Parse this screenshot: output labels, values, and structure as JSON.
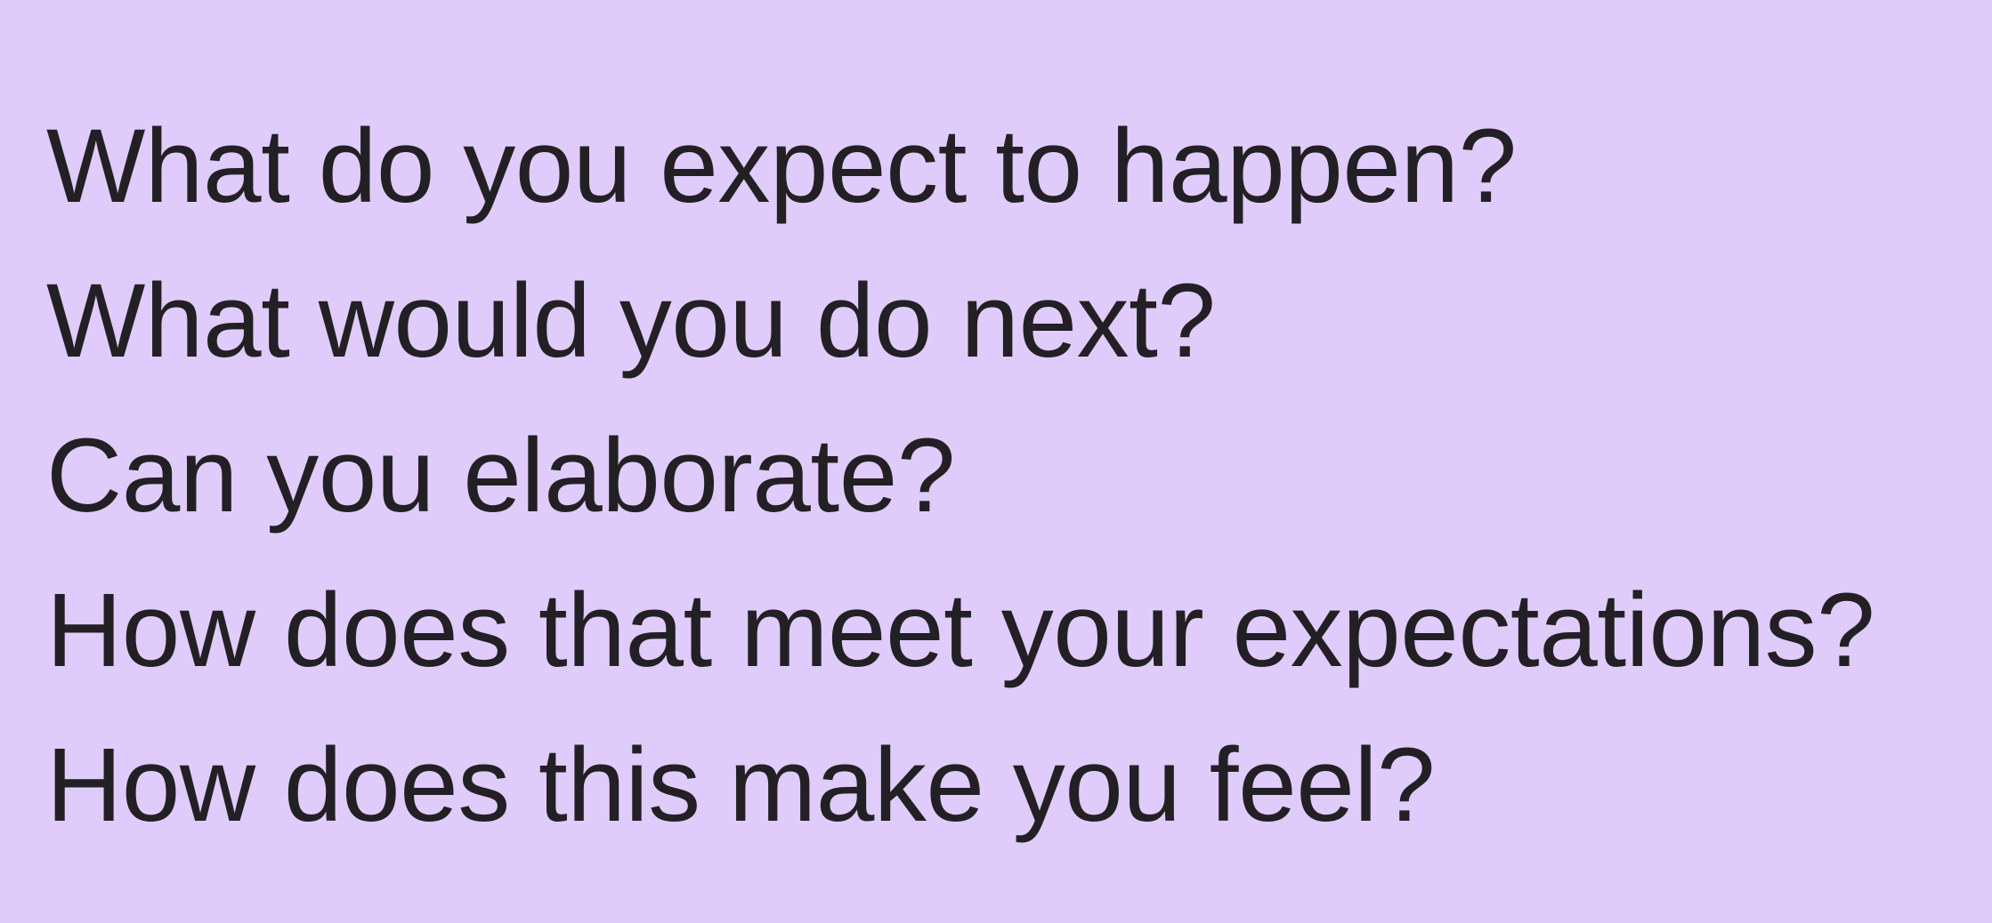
{
  "background_color": "#e0ccfa",
  "text_color": "#222024",
  "questions": [
    "What do you expect to happen?",
    "What would you do next?",
    "Can you elaborate?",
    "How does that meet your expectations?",
    "How does this make you feel?"
  ]
}
